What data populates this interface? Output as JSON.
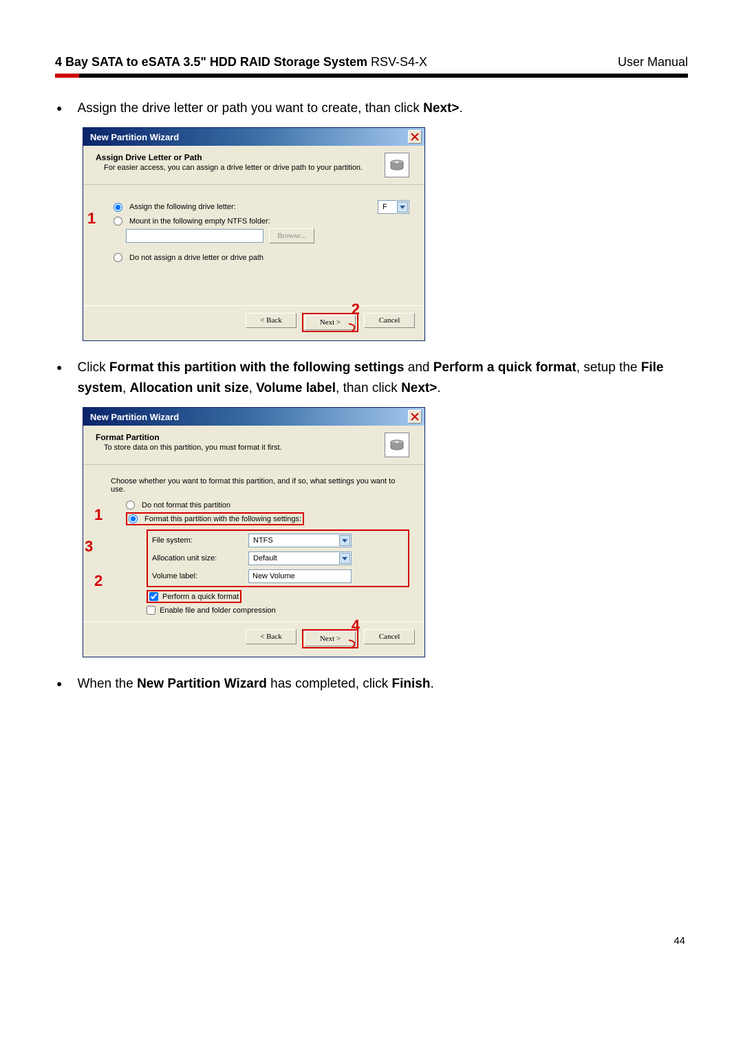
{
  "header": {
    "product_bold": "4 Bay SATA to eSATA 3.5\" HDD RAID Storage System",
    "product_model": " RSV-S4-X",
    "right": "User Manual"
  },
  "bullets": {
    "b1_pre": "Assign the drive letter or path you want to create, than click ",
    "b1_bold": "Next>",
    "b1_post": ".",
    "b2_pre": "Click ",
    "b2_bold1": "Format this partition with the following settings",
    "b2_mid1": " and ",
    "b2_bold2": "Perform a quick format",
    "b2_mid2": ", setup the ",
    "b2_bold3": "File system",
    "b2_mid3": ", ",
    "b2_bold4": "Allocation unit size",
    "b2_mid4": ", ",
    "b2_bold5": "Volume label",
    "b2_mid5": ", than click ",
    "b2_bold6": "Next>",
    "b2_post": ".",
    "b3_pre": "When the ",
    "b3_bold1": "New Partition Wizard",
    "b3_mid": " has completed, click ",
    "b3_bold2": "Finish",
    "b3_post": "."
  },
  "dlg1": {
    "title": "New Partition Wizard",
    "head_title": "Assign Drive Letter or Path",
    "head_sub": "For easier access, you can assign a drive letter or drive path to your partition.",
    "r1": "Assign the following drive letter:",
    "drive": "F",
    "r2": "Mount in the following empty NTFS folder:",
    "browse": "Browse...",
    "r3": "Do not assign a drive letter or drive path",
    "back": "< Back",
    "next": "Next >",
    "cancel": "Cancel",
    "callout1": "1",
    "callout2": "2"
  },
  "dlg2": {
    "title": "New Partition Wizard",
    "head_title": "Format Partition",
    "head_sub": "To store data on this partition, you must format it first.",
    "prompt": "Choose whether you want to format this partition, and if so, what settings you want to use.",
    "r1": "Do not format this partition",
    "r2": "Format this partition with the following settings:",
    "fs_label": "File system:",
    "fs_value": "NTFS",
    "au_label": "Allocation unit size:",
    "au_value": "Default",
    "vl_label": "Volume label:",
    "vl_value": "New Volume",
    "chk1": "Perform a quick format",
    "chk2": "Enable file and folder compression",
    "back": "< Back",
    "next": "Next >",
    "cancel": "Cancel",
    "callout1": "1",
    "callout2": "2",
    "callout3": "3",
    "callout4": "4"
  },
  "page_number": "44"
}
